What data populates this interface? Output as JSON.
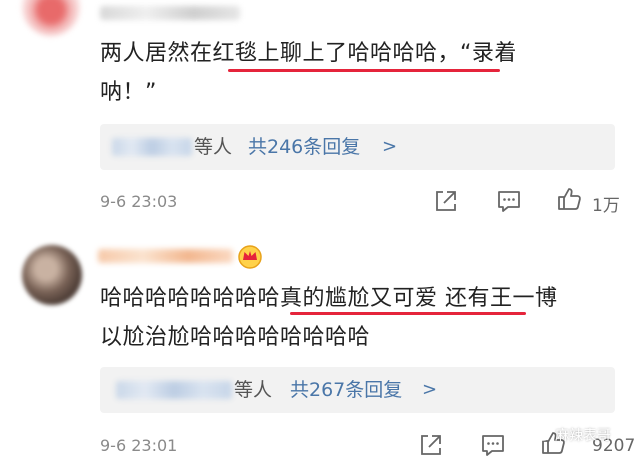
{
  "comments": [
    {
      "text_line1": "两人居然在红毯上聊上了哈哈哈哈，“录着",
      "text_line2": "呐！”",
      "reply_suffix": "等人",
      "reply_link": "共246条回复",
      "reply_chevron": ">",
      "time": "9-6 23:03",
      "likes": "1万"
    },
    {
      "text_line1": "哈哈哈哈哈哈哈哈真的尴尬又可爱 还有王一博",
      "text_line2": "以尬治尬哈哈哈哈哈哈哈哈",
      "reply_suffix": "等人",
      "reply_link": "共267条回复",
      "reply_chevron": ">",
      "time": "9-6 23:01",
      "likes": "9207"
    }
  ],
  "watermark": "麻辣表哥",
  "colors": {
    "underline": "#e5243b",
    "link": "#4a76a8",
    "reply_bg": "#f2f2f2"
  }
}
